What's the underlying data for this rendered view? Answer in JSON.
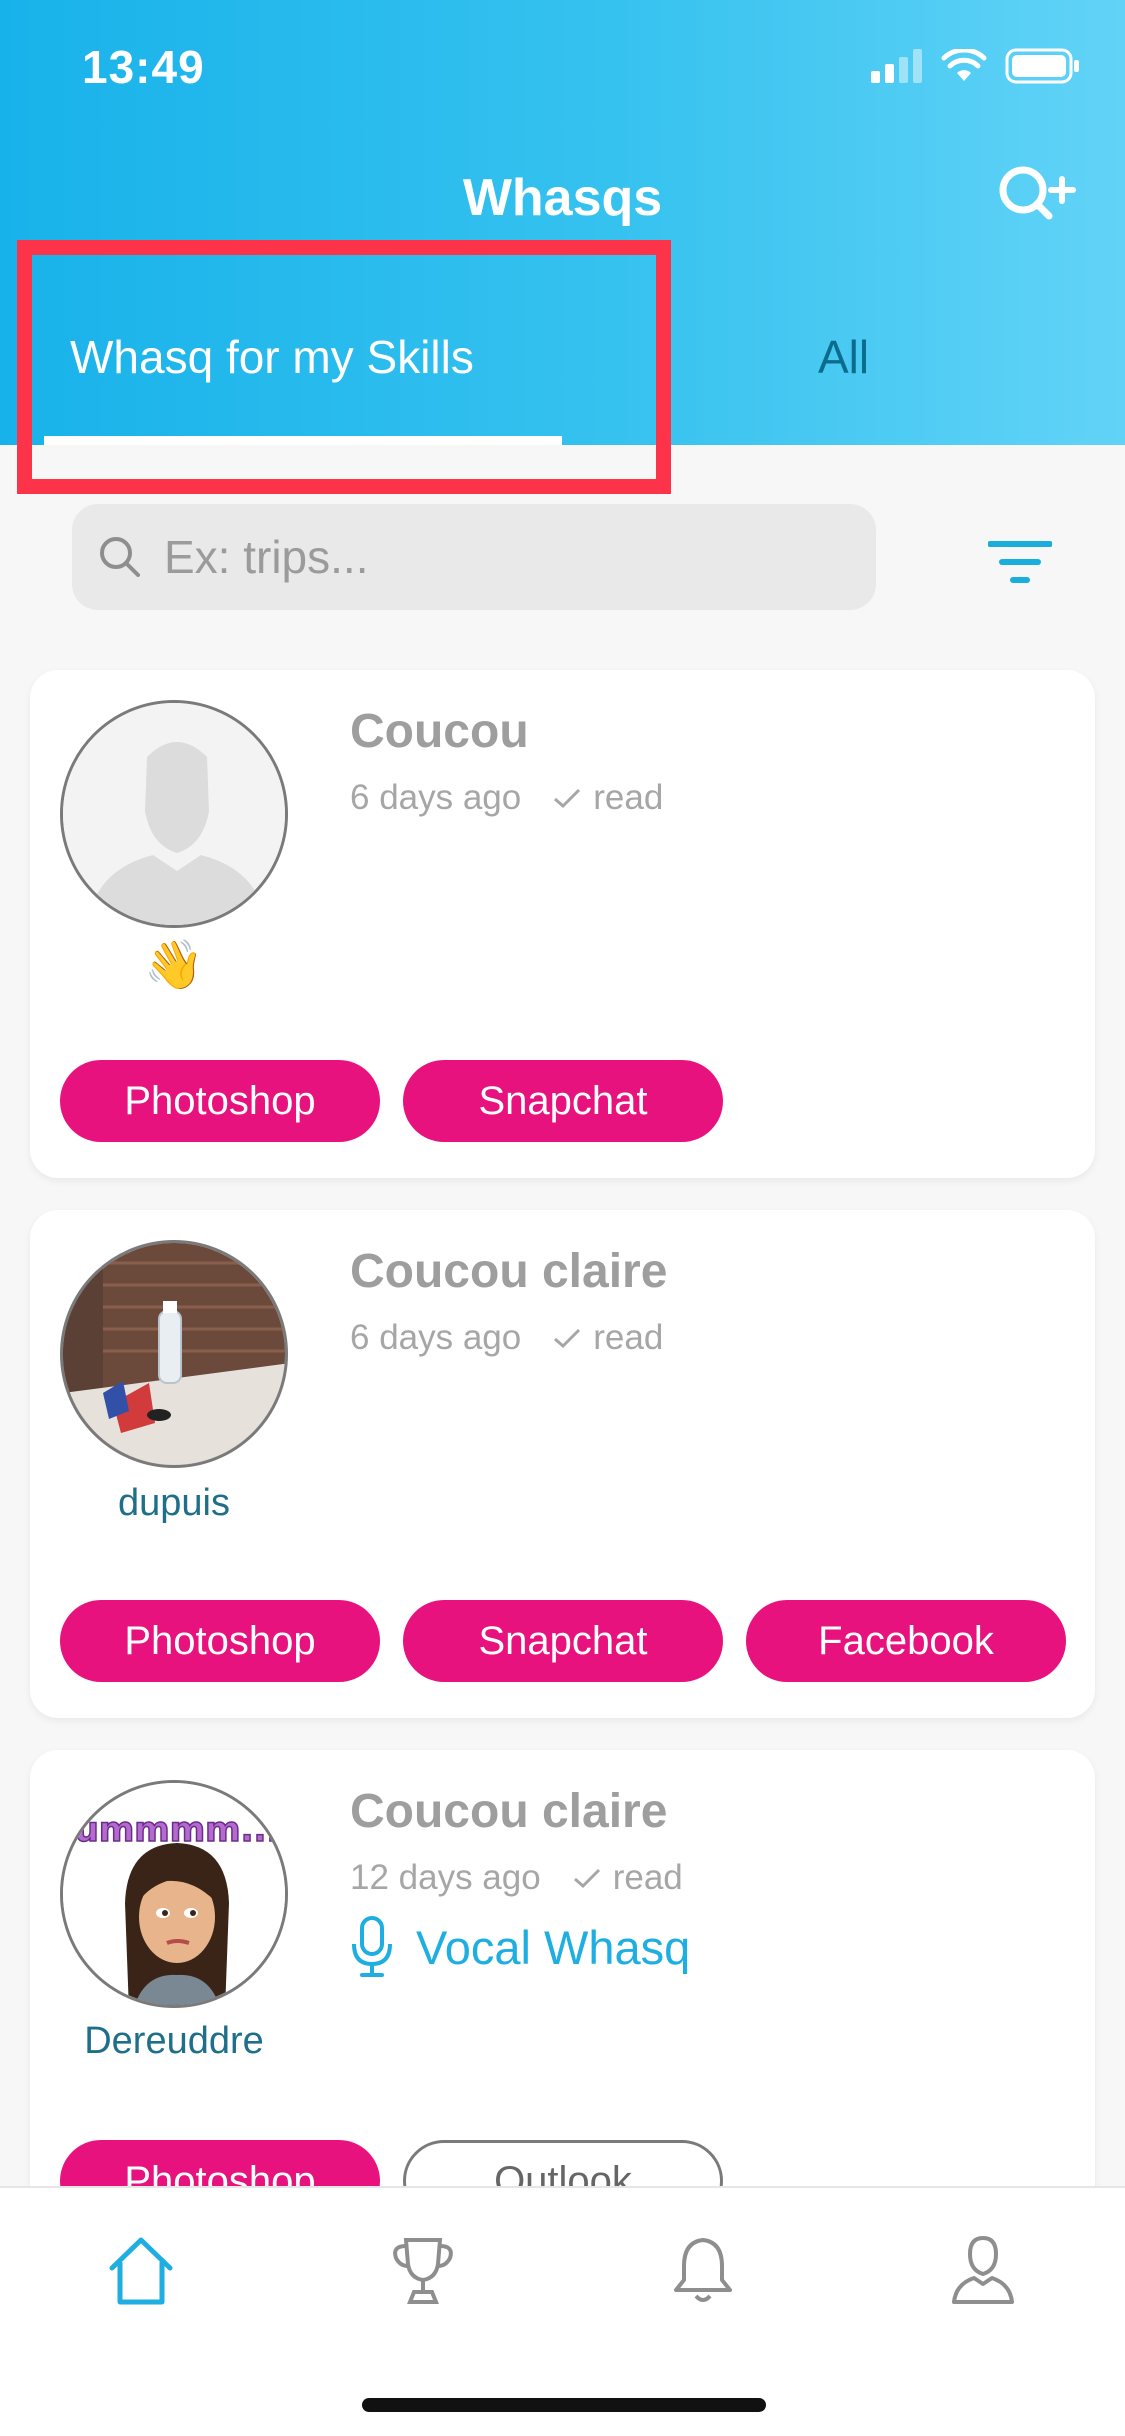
{
  "status_bar": {
    "time": "13:49"
  },
  "header": {
    "title": "Whasqs"
  },
  "tabs": [
    {
      "label": "Whasq for my Skills"
    },
    {
      "label": "All"
    }
  ],
  "search": {
    "placeholder": "Ex: trips..."
  },
  "cards": [
    {
      "author": "👋",
      "title": "Coucou",
      "time": "6 days ago",
      "status": "read",
      "vocal": "",
      "tags": [
        "Photoshop",
        "Snapchat"
      ]
    },
    {
      "author": "dupuis",
      "title": "Coucou claire",
      "time": "6 days ago",
      "status": "read",
      "vocal": "",
      "tags": [
        "Photoshop",
        "Snapchat",
        "Facebook"
      ]
    },
    {
      "author": "Dereuddre",
      "title": "Coucou claire",
      "time": "12 days ago",
      "status": "read",
      "vocal": "Vocal Whasq",
      "tags": [
        "Photoshop",
        "Outlook"
      ],
      "avatar_sticker_text": "ummmm..."
    }
  ],
  "colors": {
    "header_start": "#18b2ea",
    "header_end": "#62d3f7",
    "tag": "#e8127e",
    "highlight": "#fc3349",
    "accent": "#1eaee2"
  },
  "icons": {
    "status": [
      "signal-icon",
      "wifi-icon",
      "battery-icon"
    ],
    "tabbar": [
      "home-icon",
      "trophy-icon",
      "bell-icon",
      "profile-icon"
    ]
  }
}
